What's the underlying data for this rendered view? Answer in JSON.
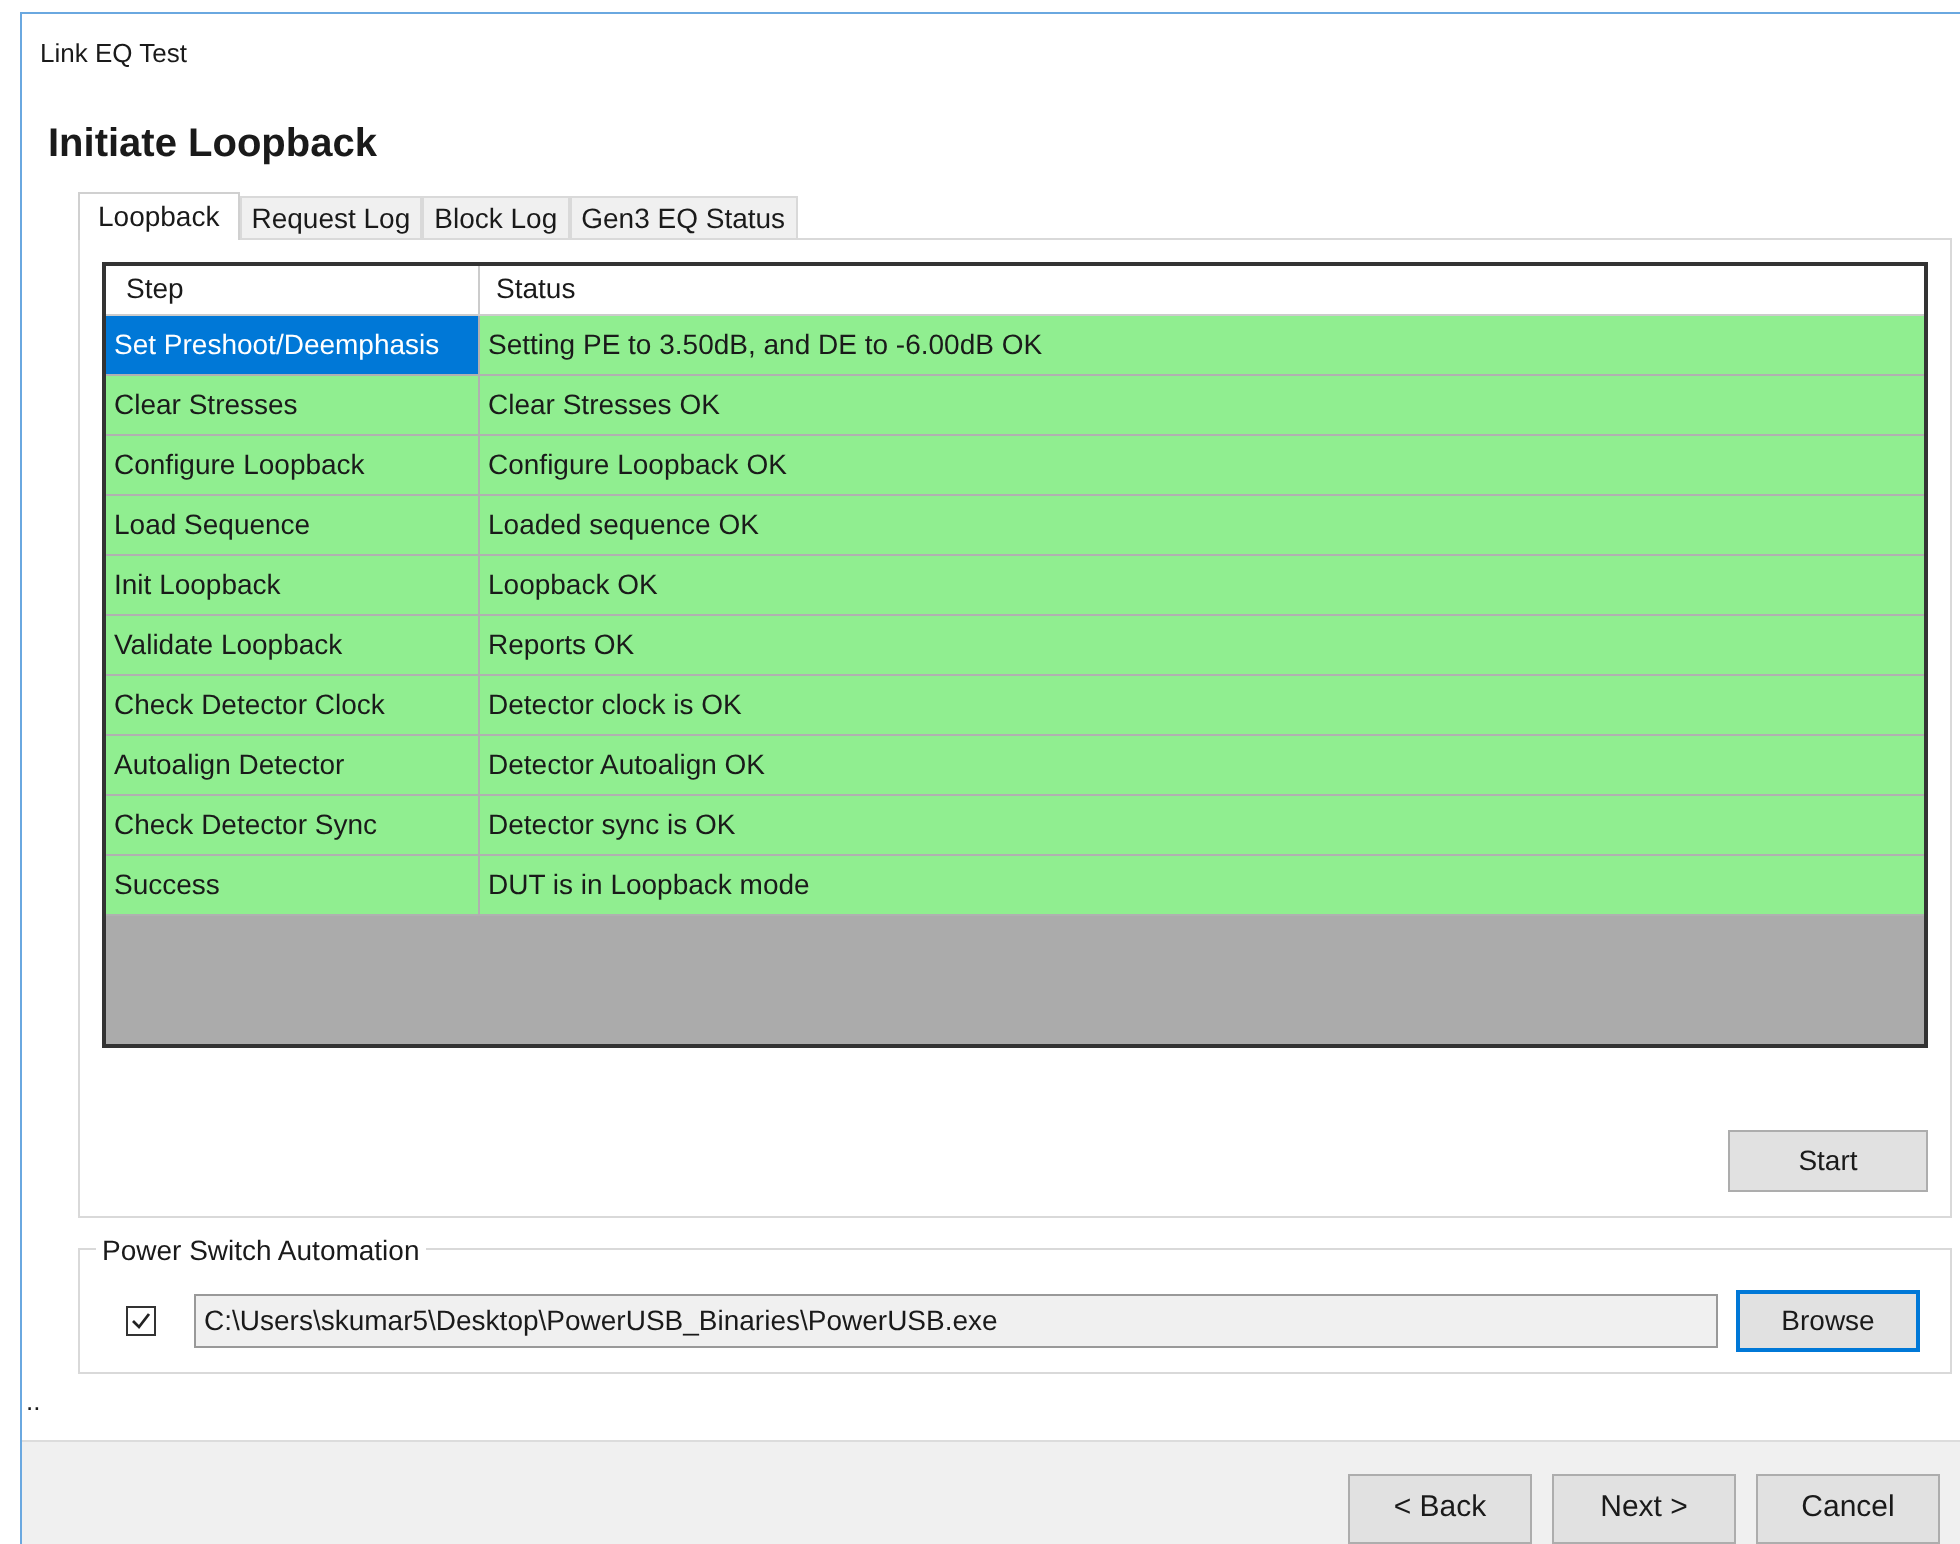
{
  "window": {
    "title": "Link EQ Test"
  },
  "heading": "Initiate Loopback",
  "tabs": [
    {
      "label": "Loopback",
      "selected": true
    },
    {
      "label": "Request Log",
      "selected": false
    },
    {
      "label": "Block Log",
      "selected": false
    },
    {
      "label": "Gen3 EQ Status",
      "selected": false
    }
  ],
  "table": {
    "columns": [
      "Step",
      "Status"
    ],
    "rows": [
      {
        "step": "Set Preshoot/Deemphasis",
        "status": "Setting PE to 3.50dB, and DE to -6.00dB OK",
        "selected": true
      },
      {
        "step": "Clear Stresses",
        "status": "Clear Stresses OK",
        "selected": false
      },
      {
        "step": "Configure Loopback",
        "status": "Configure Loopback OK",
        "selected": false
      },
      {
        "step": "Load Sequence",
        "status": "Loaded sequence OK",
        "selected": false
      },
      {
        "step": "Init Loopback",
        "status": "Loopback OK",
        "selected": false
      },
      {
        "step": "Validate Loopback",
        "status": "Reports OK",
        "selected": false
      },
      {
        "step": "Check Detector Clock",
        "status": "Detector clock is OK",
        "selected": false
      },
      {
        "step": "Autoalign Detector",
        "status": "Detector Autoalign OK",
        "selected": false
      },
      {
        "step": "Check Detector Sync",
        "status": "Detector sync is OK",
        "selected": false
      },
      {
        "step": "Success",
        "status": "DUT is in Loopback mode",
        "selected": false
      }
    ]
  },
  "start_button": "Start",
  "power_switch": {
    "title": "Power Switch Automation",
    "checked": true,
    "path": "C:\\Users\\skumar5\\Desktop\\PowerUSB_Binaries\\PowerUSB.exe",
    "browse": {
      "label": "Browse",
      "focused": true
    }
  },
  "status_text": "..",
  "footer_buttons": [
    "< Back",
    "Next >",
    "Cancel"
  ]
}
